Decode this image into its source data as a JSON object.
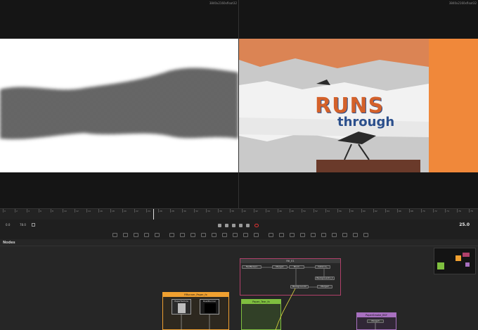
{
  "viewers": {
    "left_resolution": "3840x2160xfloat32",
    "right_resolution": "3840x2160xfloat32"
  },
  "poster": {
    "word_main": "RUNS",
    "word_sub": "through",
    "accent_color": "#f0883a",
    "text_color": "#d4612a",
    "blue_color": "#2b4f8c"
  },
  "timeline": {
    "tick_labels": [
      "0",
      "2",
      "4",
      "6",
      "8",
      "10",
      "12",
      "14",
      "16",
      "18",
      "20",
      "22",
      "24",
      "26",
      "28",
      "30",
      "32",
      "34",
      "36",
      "38",
      "40",
      "42",
      "44",
      "46",
      "48",
      "50",
      "52",
      "54",
      "56",
      "58",
      "60",
      "62",
      "64",
      "66",
      "68",
      "70",
      "72",
      "74",
      "76",
      "78"
    ]
  },
  "transport": {
    "start_frame": "0.0",
    "end_frame": "78.0",
    "current_frame": "25.0"
  },
  "nodes_panel": {
    "title": "Nodes",
    "groups": [
      {
        "title": "Rtl_01",
        "color": "#c06"
      },
      {
        "title": "RRunner_Paper_fx",
        "color": "#f0a030"
      },
      {
        "title": "Paper_Tear_fx",
        "color": "#7fbf3f"
      },
      {
        "title": "PaperSmoke_BSY",
        "color": "#a870c0"
      }
    ],
    "nodes": [
      {
        "label": "FastNoise1"
      },
      {
        "label": "Merge1"
      },
      {
        "label": "Blur1"
      },
      {
        "label": "Instance_"
      },
      {
        "label": "Background2"
      },
      {
        "label": "Merge2"
      },
      {
        "label": "Background1_1"
      },
      {
        "label": "PaperTexture"
      },
      {
        "label": "RoadRunner"
      },
      {
        "label": "Merge3"
      }
    ]
  }
}
